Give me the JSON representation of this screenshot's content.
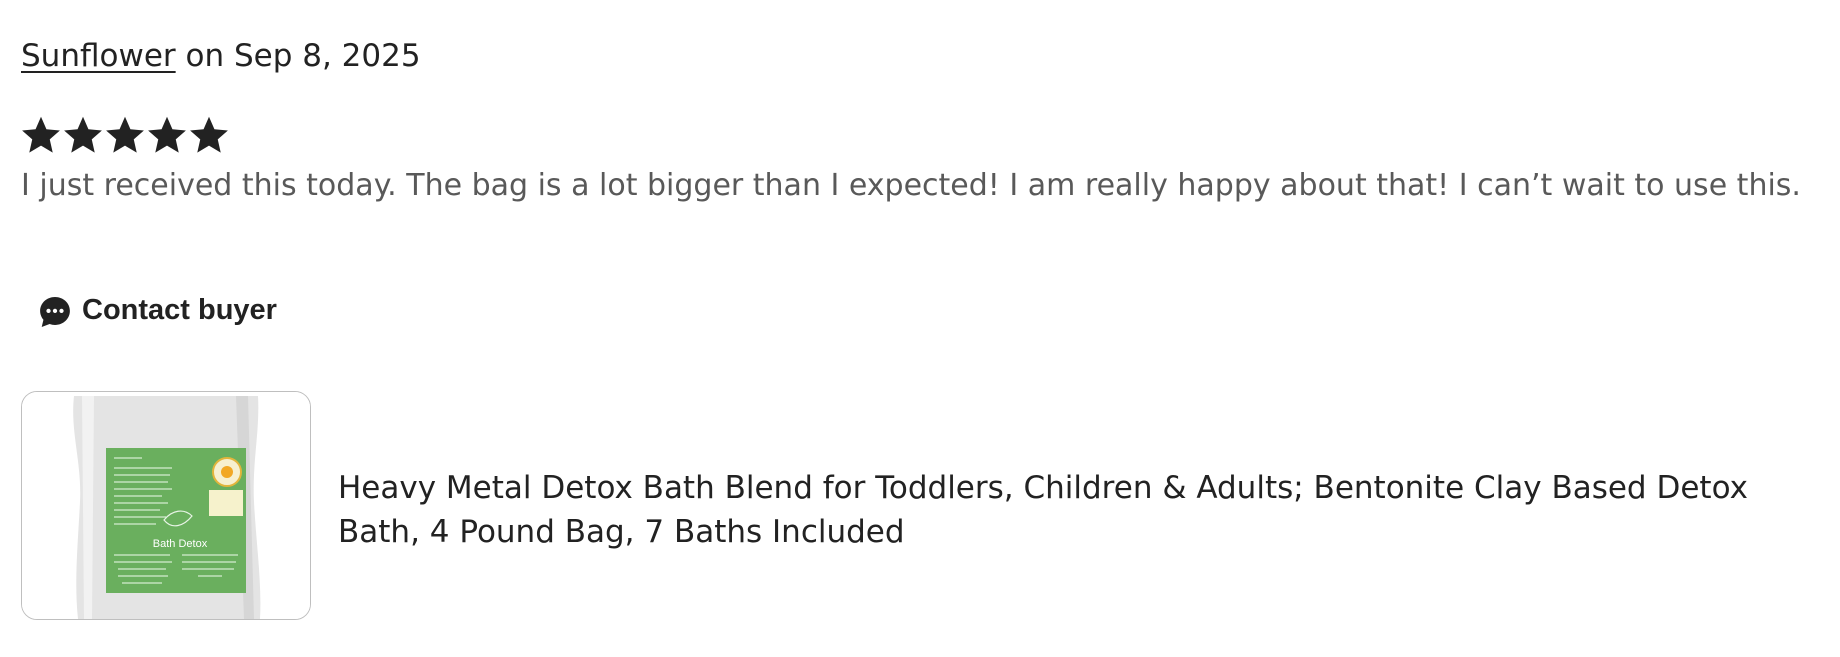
{
  "review": {
    "author": "Sunflower",
    "date_text": " on Sep 8, 2025",
    "rating": 5,
    "rating_max": 5,
    "text": "I just received this today. The bag is a lot bigger than I expected! I am really happy about that! I can’t wait to use this.",
    "star_color": "#222222"
  },
  "contact": {
    "label": "Contact buyer",
    "icon": "chat-bubble-icon"
  },
  "product": {
    "title": "Heavy Metal Detox Bath Blend for Toddlers, Children & Adults; Bentonite Clay Based Detox Bath, 4 Pound Bag, 7 Baths Included",
    "thumbnail_label": "Bath Detox",
    "label_color": "#6aaf5e",
    "bag_color": "#e6e6e6"
  }
}
